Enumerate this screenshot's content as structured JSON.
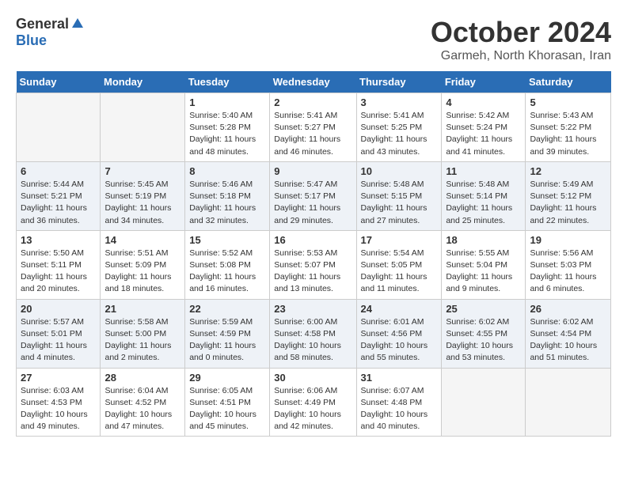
{
  "logo": {
    "general": "General",
    "blue": "Blue"
  },
  "title": "October 2024",
  "subtitle": "Garmeh, North Khorasan, Iran",
  "days_of_week": [
    "Sunday",
    "Monday",
    "Tuesday",
    "Wednesday",
    "Thursday",
    "Friday",
    "Saturday"
  ],
  "weeks": [
    [
      {
        "day": "",
        "info": ""
      },
      {
        "day": "",
        "info": ""
      },
      {
        "day": "1",
        "info": "Sunrise: 5:40 AM\nSunset: 5:28 PM\nDaylight: 11 hours and 48 minutes."
      },
      {
        "day": "2",
        "info": "Sunrise: 5:41 AM\nSunset: 5:27 PM\nDaylight: 11 hours and 46 minutes."
      },
      {
        "day": "3",
        "info": "Sunrise: 5:41 AM\nSunset: 5:25 PM\nDaylight: 11 hours and 43 minutes."
      },
      {
        "day": "4",
        "info": "Sunrise: 5:42 AM\nSunset: 5:24 PM\nDaylight: 11 hours and 41 minutes."
      },
      {
        "day": "5",
        "info": "Sunrise: 5:43 AM\nSunset: 5:22 PM\nDaylight: 11 hours and 39 minutes."
      }
    ],
    [
      {
        "day": "6",
        "info": "Sunrise: 5:44 AM\nSunset: 5:21 PM\nDaylight: 11 hours and 36 minutes."
      },
      {
        "day": "7",
        "info": "Sunrise: 5:45 AM\nSunset: 5:19 PM\nDaylight: 11 hours and 34 minutes."
      },
      {
        "day": "8",
        "info": "Sunrise: 5:46 AM\nSunset: 5:18 PM\nDaylight: 11 hours and 32 minutes."
      },
      {
        "day": "9",
        "info": "Sunrise: 5:47 AM\nSunset: 5:17 PM\nDaylight: 11 hours and 29 minutes."
      },
      {
        "day": "10",
        "info": "Sunrise: 5:48 AM\nSunset: 5:15 PM\nDaylight: 11 hours and 27 minutes."
      },
      {
        "day": "11",
        "info": "Sunrise: 5:48 AM\nSunset: 5:14 PM\nDaylight: 11 hours and 25 minutes."
      },
      {
        "day": "12",
        "info": "Sunrise: 5:49 AM\nSunset: 5:12 PM\nDaylight: 11 hours and 22 minutes."
      }
    ],
    [
      {
        "day": "13",
        "info": "Sunrise: 5:50 AM\nSunset: 5:11 PM\nDaylight: 11 hours and 20 minutes."
      },
      {
        "day": "14",
        "info": "Sunrise: 5:51 AM\nSunset: 5:09 PM\nDaylight: 11 hours and 18 minutes."
      },
      {
        "day": "15",
        "info": "Sunrise: 5:52 AM\nSunset: 5:08 PM\nDaylight: 11 hours and 16 minutes."
      },
      {
        "day": "16",
        "info": "Sunrise: 5:53 AM\nSunset: 5:07 PM\nDaylight: 11 hours and 13 minutes."
      },
      {
        "day": "17",
        "info": "Sunrise: 5:54 AM\nSunset: 5:05 PM\nDaylight: 11 hours and 11 minutes."
      },
      {
        "day": "18",
        "info": "Sunrise: 5:55 AM\nSunset: 5:04 PM\nDaylight: 11 hours and 9 minutes."
      },
      {
        "day": "19",
        "info": "Sunrise: 5:56 AM\nSunset: 5:03 PM\nDaylight: 11 hours and 6 minutes."
      }
    ],
    [
      {
        "day": "20",
        "info": "Sunrise: 5:57 AM\nSunset: 5:01 PM\nDaylight: 11 hours and 4 minutes."
      },
      {
        "day": "21",
        "info": "Sunrise: 5:58 AM\nSunset: 5:00 PM\nDaylight: 11 hours and 2 minutes."
      },
      {
        "day": "22",
        "info": "Sunrise: 5:59 AM\nSunset: 4:59 PM\nDaylight: 11 hours and 0 minutes."
      },
      {
        "day": "23",
        "info": "Sunrise: 6:00 AM\nSunset: 4:58 PM\nDaylight: 10 hours and 58 minutes."
      },
      {
        "day": "24",
        "info": "Sunrise: 6:01 AM\nSunset: 4:56 PM\nDaylight: 10 hours and 55 minutes."
      },
      {
        "day": "25",
        "info": "Sunrise: 6:02 AM\nSunset: 4:55 PM\nDaylight: 10 hours and 53 minutes."
      },
      {
        "day": "26",
        "info": "Sunrise: 6:02 AM\nSunset: 4:54 PM\nDaylight: 10 hours and 51 minutes."
      }
    ],
    [
      {
        "day": "27",
        "info": "Sunrise: 6:03 AM\nSunset: 4:53 PM\nDaylight: 10 hours and 49 minutes."
      },
      {
        "day": "28",
        "info": "Sunrise: 6:04 AM\nSunset: 4:52 PM\nDaylight: 10 hours and 47 minutes."
      },
      {
        "day": "29",
        "info": "Sunrise: 6:05 AM\nSunset: 4:51 PM\nDaylight: 10 hours and 45 minutes."
      },
      {
        "day": "30",
        "info": "Sunrise: 6:06 AM\nSunset: 4:49 PM\nDaylight: 10 hours and 42 minutes."
      },
      {
        "day": "31",
        "info": "Sunrise: 6:07 AM\nSunset: 4:48 PM\nDaylight: 10 hours and 40 minutes."
      },
      {
        "day": "",
        "info": ""
      },
      {
        "day": "",
        "info": ""
      }
    ]
  ]
}
